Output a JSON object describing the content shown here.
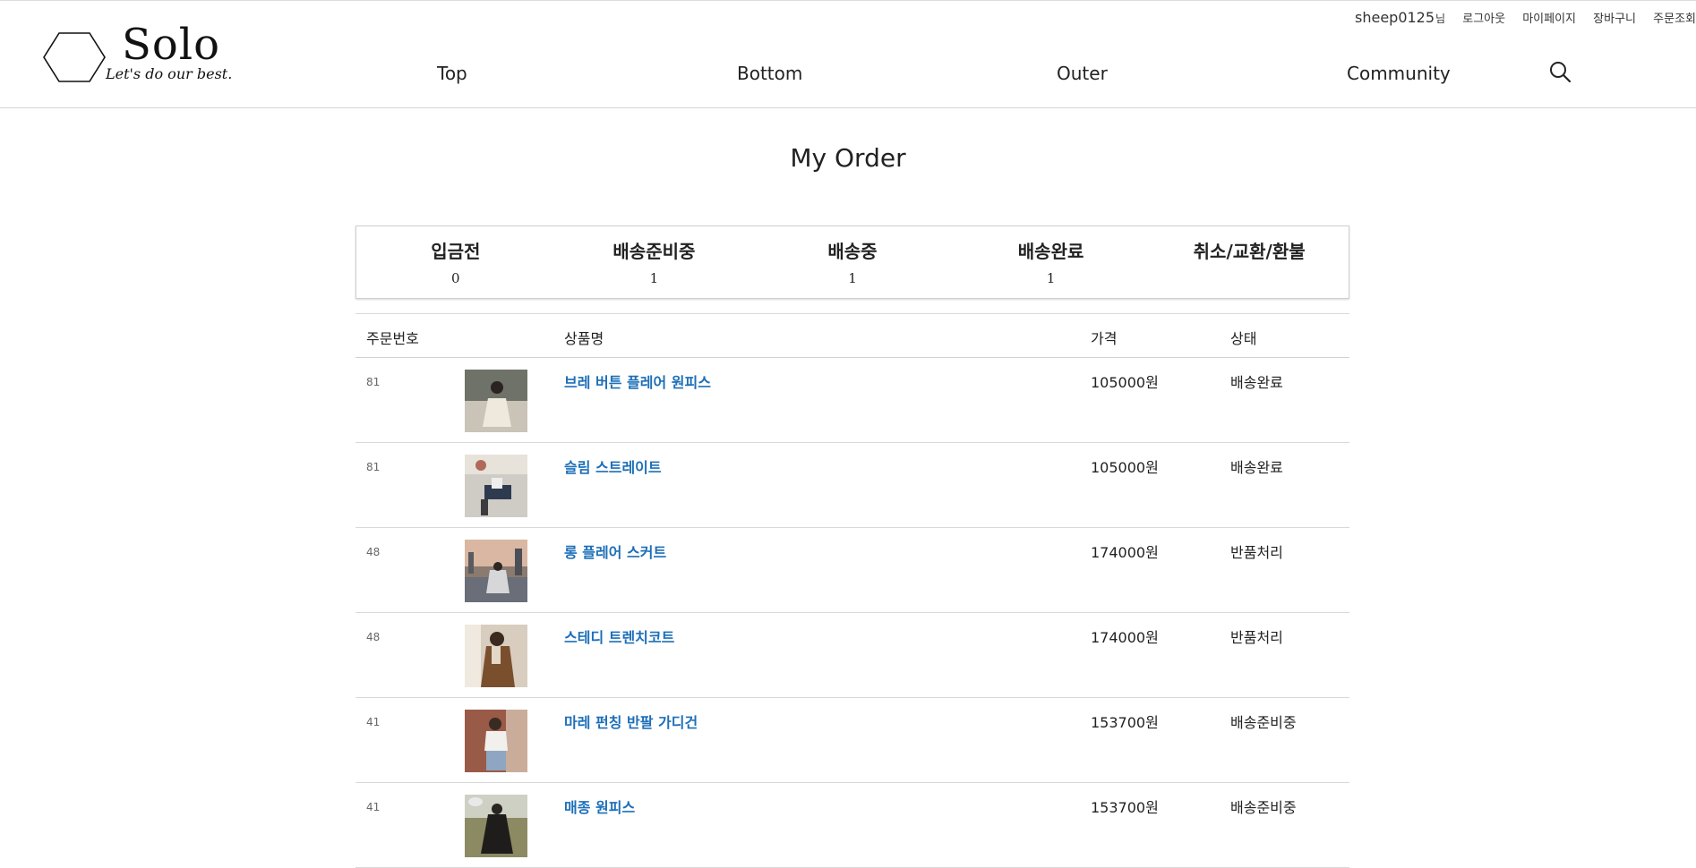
{
  "header": {
    "logo": {
      "title": "Solo",
      "subtitle": "Let's do our best."
    },
    "user": {
      "name": "sheep0125",
      "suffix": "님"
    },
    "util_links": [
      "로그아웃",
      "마이페이지",
      "장바구니",
      "주문조회"
    ],
    "nav": [
      "Top",
      "Bottom",
      "Outer",
      "Community"
    ]
  },
  "page": {
    "title": "My Order"
  },
  "summary": [
    {
      "label": "입금전",
      "count": "0"
    },
    {
      "label": "배송준비중",
      "count": "1"
    },
    {
      "label": "배송중",
      "count": "1"
    },
    {
      "label": "배송완료",
      "count": "1"
    },
    {
      "label": "취소/교환/환불",
      "count": ""
    }
  ],
  "table": {
    "headers": {
      "order_no": "주문번호",
      "product": "상품명",
      "price": "가격",
      "status": "상태"
    },
    "rows": [
      {
        "order_no": "81",
        "product": "브레 버튼 플레어 원피스",
        "price": "105000원",
        "status": "배송완료"
      },
      {
        "order_no": "81",
        "product": "슬림 스트레이트",
        "price": "105000원",
        "status": "배송완료"
      },
      {
        "order_no": "48",
        "product": "롱 플레어 스커트",
        "price": "174000원",
        "status": "반품처리"
      },
      {
        "order_no": "48",
        "product": "스테디 트렌치코트",
        "price": "174000원",
        "status": "반품처리"
      },
      {
        "order_no": "41",
        "product": "마레 펀칭 반팔 가디건",
        "price": "153700원",
        "status": "배송준비중"
      },
      {
        "order_no": "41",
        "product": "매종 원피스",
        "price": "153700원",
        "status": "배송준비중"
      }
    ]
  },
  "colors": {
    "link": "#1d6fb8",
    "border": "#d9d9d9",
    "text": "#222222"
  }
}
